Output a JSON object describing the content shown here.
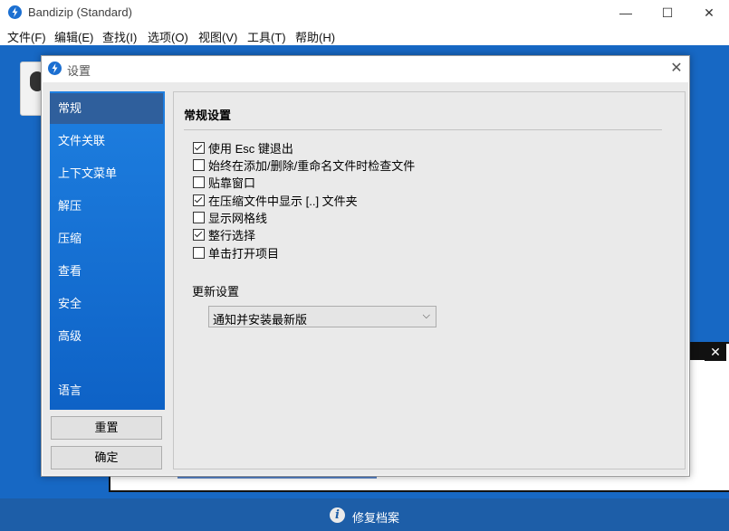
{
  "window": {
    "title": "Bandizip (Standard)",
    "minimize_glyph": "—",
    "maximize_glyph": "☐",
    "close_glyph": "✕"
  },
  "menu": [
    "文件(F)",
    "编辑(E)",
    "查找(I)",
    "选项(O)",
    "视图(V)",
    "工具(T)",
    "帮助(H)"
  ],
  "bottom_bar": {
    "icon": "info-icon",
    "icon_glyph": "i",
    "label": "修复档案"
  },
  "sub_panel": {
    "close_glyph": "✕"
  },
  "dialog": {
    "title": "设置",
    "close_glyph": "✕",
    "sidebar": {
      "items": [
        "常规",
        "文件关联",
        "上下文菜单",
        "解压",
        "压缩",
        "查看",
        "安全",
        "高级",
        "语言"
      ],
      "active_index": 0
    },
    "buttons": {
      "reset": "重置",
      "ok": "确定"
    },
    "content": {
      "title": "常规设置",
      "options": [
        {
          "label": "使用 Esc 键退出",
          "checked": true
        },
        {
          "label": "始终在添加/删除/重命名文件时检查文件",
          "checked": false
        },
        {
          "label": "贴靠窗口",
          "checked": false
        },
        {
          "label": "在压缩文件中显示 [..] 文件夹",
          "checked": true
        },
        {
          "label": "显示网格线",
          "checked": false
        },
        {
          "label": "整行选择",
          "checked": true
        },
        {
          "label": "单击打开项目",
          "checked": false
        }
      ],
      "update_label": "更新设置",
      "update_select": {
        "value": "通知并安装最新版",
        "arrow_glyph": "⌵"
      }
    }
  }
}
